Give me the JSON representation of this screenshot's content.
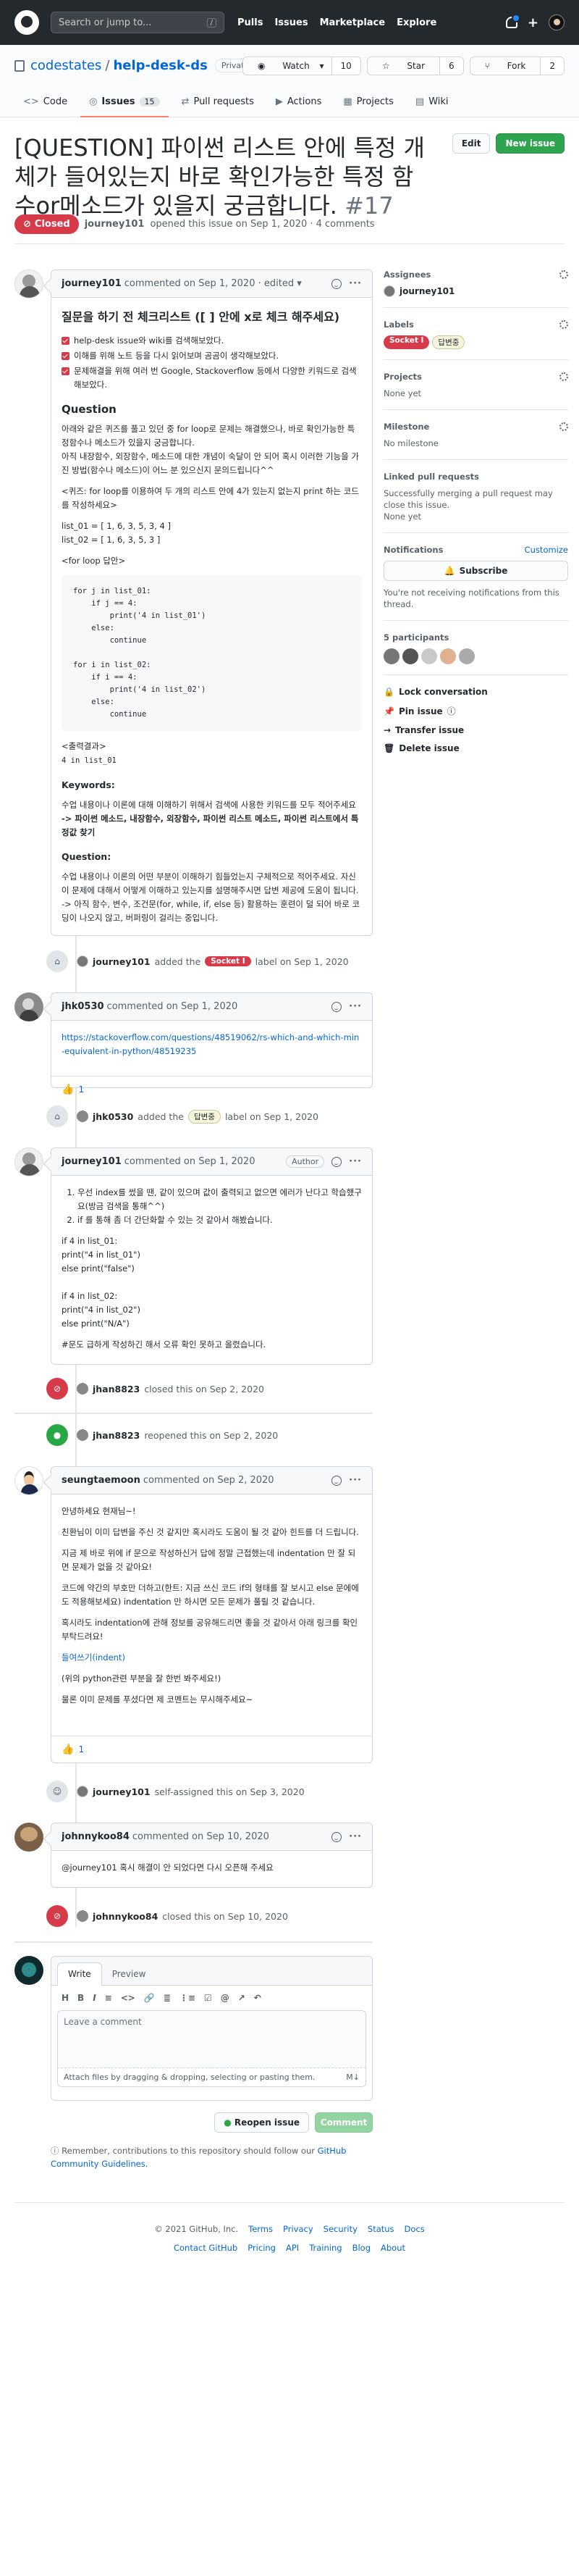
{
  "header": {
    "search_placeholder": "Search or jump to...",
    "slash": "/",
    "nav": [
      "Pulls",
      "Issues",
      "Marketplace",
      "Explore"
    ],
    "plus": "+"
  },
  "repo": {
    "owner": "codestates",
    "sep": "/",
    "name": "help-desk-ds",
    "visibility": "Private",
    "watch_label": "Watch",
    "watch_count": "10",
    "star_label": "Star",
    "star_count": "6",
    "fork_label": "Fork",
    "fork_count": "2",
    "tabs": [
      {
        "label": "Code",
        "icon": "<>"
      },
      {
        "label": "Issues",
        "count": "15",
        "icon": "◎"
      },
      {
        "label": "Pull requests",
        "icon": "⇄"
      },
      {
        "label": "Actions",
        "icon": "▶"
      },
      {
        "label": "Projects",
        "icon": "▦"
      },
      {
        "label": "Wiki",
        "icon": "▤"
      }
    ]
  },
  "issue": {
    "title": "[QUESTION] 파이썬 리스트 안에 특정 개체가 들어있는지 바로 확인가능한 특정 함수or메소드가 있을지 궁금합니다.",
    "number": "#17",
    "edit_label": "Edit",
    "new_issue_label": "New issue",
    "state": "Closed",
    "opened_by": "journey101",
    "opened_text": "opened this issue on Sep 1, 2020 · 4 comments"
  },
  "comment1": {
    "author": "journey101",
    "meta": "commented on Sep 1, 2020 · edited",
    "heading": "질문을 하기 전 체크리스트 ([ ] 안에 x로 체크 해주세요)",
    "tasks": [
      "help-desk issue와 wiki를 검색해보았다.",
      "이해를 위해 노트 등을 다시 읽어보며 곰곰이 생각해보았다.",
      "문제해결을 위해 여러 번 Google, Stackoverflow 등에서 다양한 키워드로 검색해보았다."
    ],
    "q_title": "Question",
    "q_p1": "아래와 같은 퀴즈를 풀고 있던 중 for loop로 문제는 해결했으나, 바로 확인가능한 특정함수나 메소드가 있을지 궁금합니다.",
    "q_p2": "아직 내장함수, 외장함수, 메소드에 대한 개념이 숙달이 안 되어 혹시 이러한 기능을 가진 방법(함수나 메소드)이 어느 분 있으신지 문의드립니다^^",
    "q_p3": "<퀴즈: for loop를 이용하여 두 개의 리스트 안에 4가 있는지 없는지 print 하는 코드를 작성하세요>",
    "list01": "list_01 = [ 1, 6, 3, 5, 3, 4 ]",
    "list02": "list_02 = [ 1, 6, 3, 5, 3 ]",
    "forloop": "<for loop 답안>",
    "code": "for j in list_01:\n    if j == 4:\n        print('4 in list_01')\n    else:\n        continue\n\nfor i in list_02:\n    if i == 4:\n        print('4 in list_02')\n    else:\n        continue",
    "output_label": "<출력결과>",
    "output": "4 in list_01",
    "kw_title": "Keywords:",
    "kw_text": "수업 내용이나 이론에 대해 이해하기 위해서 검색에 사용한 키워드를 모두 적어주세요",
    "kw_list": "-> 파이썬 메소드, 내장함수, 외장함수, 파이썬 리스트 메소드, 파이썬 리스트에서 특정값 찾기",
    "q2_title": "Question:",
    "q2_text1": "수업 내용이나 이론의 어떤 부분이 이해하기 힘들었는지 구체적으로 적어주세요. 자신이 문제에 대해서 어떻게 이해하고 있는지를 설명해주시면 답변 제공에 도움이 됩니다.",
    "q2_text2": "-> 아직 함수, 변수, 조건문(for, while, if, else 등) 활용하는 훈련이 덜 되어 바로 코딩이 나오지 않고, 버퍼링이 걸리는 중입니다."
  },
  "event1": {
    "actor": "journey101",
    "pre": "added the",
    "label": "Socket I",
    "post": "label on Sep 1, 2020"
  },
  "comment2": {
    "author": "jhk0530",
    "meta": "commented on Sep 1, 2020",
    "link": "https://stackoverflow.com/questions/48519062/rs-which-and-which-min-equivalent-in-python/48519235",
    "reaction_count": "1"
  },
  "event2": {
    "actor": "jhk0530",
    "pre": "added the",
    "label": "답변중",
    "post": "label on Sep 1, 2020"
  },
  "comment3": {
    "author": "journey101",
    "meta": "commented on Sep 1, 2020",
    "badge": "Author",
    "item1": "우선 index를 썼을 땐, 같이 있으며 값이 출력되고 없으면 에러가 난다고 학습했구요(방금 검색을 통해^^)",
    "item2": "if 를 통해 좀 더 간단화할 수 있는 것 같아서 해봤습니다.",
    "code_lines": [
      "if 4 in list_01:",
      "print(\"4 in list_01\")",
      "else print(\"false\")",
      "",
      "if 4 in list_02:",
      "print(\"4 in list_02\")",
      "else print(\"N/A\")"
    ],
    "note": "#문도 급하게 작성하긴 해서 오류 확인 못하고 올렸습니다."
  },
  "event3": {
    "actor": "jhan8823",
    "post": "closed this on Sep 2, 2020"
  },
  "event4": {
    "actor": "jhan8823",
    "post": "reopened this on Sep 2, 2020"
  },
  "comment4": {
    "author": "seungtaemoon",
    "meta": "commented on Sep 2, 2020",
    "p1": "안녕하세요 현재님~!",
    "p2": "친환님이 이미 답변을 주신 것 같지만 혹시라도 도움이 될 것 같아 힌트를 더 드립니다.",
    "p3": "지금 제 바로 위에 if 문으로 작성하신거 답에 정말 근접했는데 indentation 만 잘 되면 문제가 없을 것 같아요!",
    "p4": "코드에 약간의 부호만 더하고(한트: 지금 쓰신 코드 if의 형태를 잘 보시고 else 문에에도 적용해보세요) indentation 만 하시면 모든 문제가 풀릴 것 같습니다.",
    "p5": "혹시라도 indentation에 관해 정보를 공유해드리면 좋을 것 같아서 아래 링크를 확인 부탁드려요!",
    "link": "들여쓰기(indent)",
    "p6": "(위의 python관련 부분을 잘 한번 봐주세요!)",
    "p7": "물론 이미 문제를 푸셨다면 제 코멘트는 무시해주세요~",
    "reaction_count": "1"
  },
  "event5": {
    "actor": "journey101",
    "post": "self-assigned this on Sep 3, 2020"
  },
  "comment5": {
    "author": "johnnykoo84",
    "meta": "commented on Sep 10, 2020",
    "text": "@journey101 혹시 해결이 안 되었다면 다시 오픈해 주세요"
  },
  "event6": {
    "actor": "johnnykoo84",
    "post": "closed this on Sep 10, 2020"
  },
  "sidebar": {
    "assignees_title": "Assignees",
    "assignee": "journey101",
    "labels_title": "Labels",
    "labels": [
      "Socket I",
      "답변중"
    ],
    "projects_title": "Projects",
    "projects_text": "None yet",
    "milestone_title": "Milestone",
    "milestone_text": "No milestone",
    "linked_title": "Linked pull requests",
    "linked_text": "Successfully merging a pull request may close this issue.",
    "linked_value": "None yet",
    "notif_title": "Notifications",
    "notif_customize": "Customize",
    "subscribe": "Subscribe",
    "notif_text": "You're not receiving notifications from this thread.",
    "participants_title": "5 participants",
    "actions": [
      "Lock conversation",
      "Pin issue",
      "Transfer issue",
      "Delete issue"
    ]
  },
  "composer": {
    "write_tab": "Write",
    "preview_tab": "Preview",
    "toolbar": [
      "H",
      "B",
      "I",
      "≡",
      "<>",
      "🔗",
      "≣",
      "⋮≡",
      "☑",
      "@",
      "↗",
      "↶"
    ],
    "placeholder": "Leave a comment",
    "attach": "Attach files by dragging & dropping, selecting or pasting them.",
    "md": "M↓",
    "reopen": "Reopen issue",
    "comment": "Comment",
    "guideline_pre": "Remember, contributions to this repository should follow our",
    "guideline_link": "GitHub Community Guidelines",
    "guideline_post": "."
  },
  "footer": {
    "copyright": "© 2021 GitHub, Inc.",
    "row1": [
      "Terms",
      "Privacy",
      "Security",
      "Status",
      "Docs"
    ],
    "row2": [
      "Contact GitHub",
      "Pricing",
      "API",
      "Training",
      "Blog",
      "About"
    ]
  },
  "colors": {
    "closed": "#d73a49",
    "open": "#28a745",
    "link": "#0366d6",
    "header": "#24292e"
  }
}
